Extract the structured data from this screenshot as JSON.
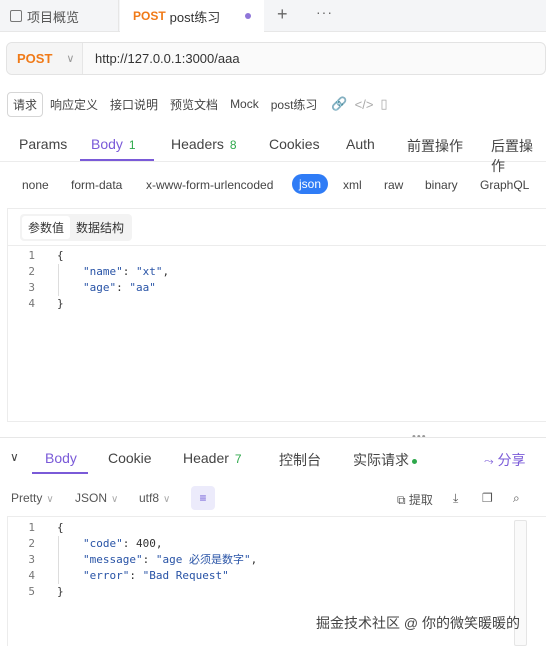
{
  "tabs": {
    "overview_label": "项目概览",
    "active_method": "POST",
    "active_label": "post练习",
    "plus": "+",
    "more": "···"
  },
  "request": {
    "method": "POST",
    "url": "http://127.0.0.1:3000/aaa"
  },
  "subtools": {
    "items": [
      "请求",
      "响应定义",
      "接口说明",
      "预览文档",
      "Mock"
    ],
    "name": "post练习"
  },
  "param_tabs": {
    "params": "Params",
    "body": "Body",
    "body_count": "1",
    "headers": "Headers",
    "headers_count": "8",
    "cookies": "Cookies",
    "auth": "Auth",
    "pre": "前置操作",
    "post": "后置操作"
  },
  "body_types": [
    "none",
    "form-data",
    "x-www-form-urlencoded",
    "json",
    "xml",
    "raw",
    "binary",
    "GraphQL"
  ],
  "editor_tabs": [
    "参数值",
    "数据结构"
  ],
  "request_body": {
    "line_numbers": [
      "1",
      "2",
      "3",
      "4"
    ],
    "l1": "{",
    "l2_key": "\"name\"",
    "l2_colon": ": ",
    "l2_val": "\"xt\"",
    "l2_end": ",",
    "l3_key": "\"age\"",
    "l3_colon": ": ",
    "l3_val": "\"aa\"",
    "l4": "}"
  },
  "response_tabs": {
    "body": "Body",
    "cookie": "Cookie",
    "header": "Header",
    "header_count": "7",
    "console": "控制台",
    "actual": "实际请求",
    "share": "分享"
  },
  "response_tools": {
    "format": "Pretty",
    "lang": "JSON",
    "encoding": "utf8",
    "extract": "提取"
  },
  "response_body": {
    "line_numbers": [
      "1",
      "2",
      "3",
      "4",
      "5"
    ],
    "l1": "{",
    "l2_key": "\"code\"",
    "l2_rest": ": 400,",
    "l3_key": "\"message\"",
    "l3_colon": ": ",
    "l3_val": "\"age 必须是数字\"",
    "l3_end": ",",
    "l4_key": "\"error\"",
    "l4_colon": ": ",
    "l4_val": "\"Bad Request\"",
    "l5": "}"
  },
  "watermark": "掘金技术社区 @ 你的微笑暖暖的",
  "colors": {
    "accent": "#7a5ad8",
    "method": "#f07a18",
    "json_pill": "#2f7cf6",
    "count": "#2ea84b"
  }
}
